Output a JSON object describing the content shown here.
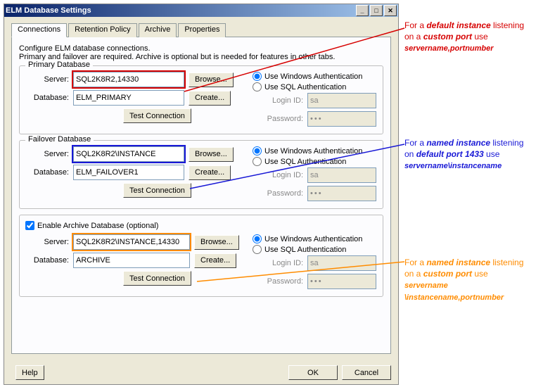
{
  "window": {
    "title": "ELM Database Settings"
  },
  "tabs": {
    "connections": "Connections",
    "retention": "Retention Policy",
    "archive": "Archive",
    "properties": "Properties"
  },
  "intro": {
    "line1": "Configure ELM database connections.",
    "line2": "Primary and failover are required. Archive is optional but is needed for features in other tabs."
  },
  "labels": {
    "server": "Server:",
    "database": "Database:",
    "browse": "Browse...",
    "create": "Create...",
    "test": "Test Connection",
    "login": "Login ID:",
    "password": "Password:",
    "auth_win": "Use Windows Authentication",
    "auth_sql": "Use SQL Authentication",
    "help": "Help",
    "ok": "OK",
    "cancel": "Cancel"
  },
  "primary": {
    "title": "Primary Database",
    "server": "SQL2K8R2,14330",
    "database": "ELM_PRIMARY",
    "login": "sa",
    "password": "•••"
  },
  "failover": {
    "title": "Failover Database",
    "server": "SQL2K8R2\\INSTANCE",
    "database": "ELM_FAILOVER1",
    "login": "sa",
    "password": "•••"
  },
  "archive": {
    "enable_label": "Enable Archive Database (optional)",
    "server": "SQL2K8R2\\INSTANCE,14330",
    "database": "ARCHIVE",
    "login": "sa",
    "password": "•••"
  },
  "annotations": {
    "red_p1": "For a ",
    "red_b1": "default instance",
    "red_p2": " listening on a ",
    "red_b2": "custom port",
    "red_p3": " use",
    "red_ex": "servername,portnumber",
    "blue_p1": "For a ",
    "blue_b1": "named instance",
    "blue_p2": " listening on ",
    "blue_b2": "default port 1433",
    "blue_p3": " use",
    "blue_ex": "servername\\instancename",
    "orange_p1": "For a ",
    "orange_b1": "named instance",
    "orange_p2": " listening on a ",
    "orange_b2": "custom port",
    "orange_p3": " use ",
    "orange_ex": "servername \\instancename,portnumber"
  }
}
